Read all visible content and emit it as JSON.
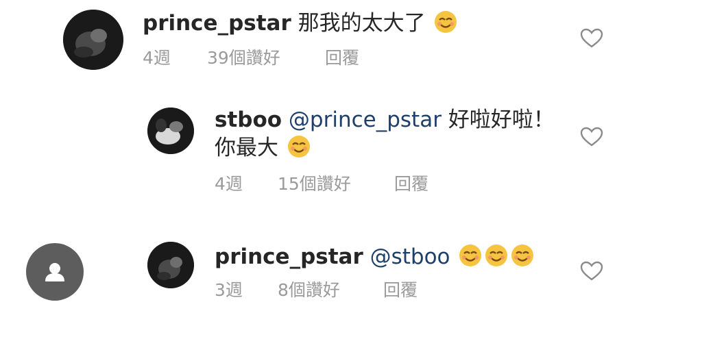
{
  "comments": [
    {
      "username": "prince_pstar",
      "text": "那我的太大了",
      "emojis": 1,
      "age": "4週",
      "likes": "39個讚好",
      "reply": "回覆"
    },
    {
      "username": "stboo",
      "mention": "@prince_pstar",
      "text_line1": "好啦好啦！",
      "text_line2": "你最大",
      "emojis": 1,
      "age": "4週",
      "likes": "15個讚好",
      "reply": "回覆"
    },
    {
      "username": "prince_pstar",
      "mention": "@stboo",
      "emojis": 3,
      "age": "3週",
      "likes": "8個讚好",
      "reply": "回覆"
    }
  ],
  "icons": {
    "like": "heart-outline-icon",
    "profile": "user-silhouette-icon",
    "emoji": "smiling-face-emoji"
  },
  "colors": {
    "meta_text": "#9a9a9a",
    "mention": "#1f3f6b",
    "emoji_face": "#f5c542",
    "placeholder_avatar": "#5d5d5d"
  }
}
